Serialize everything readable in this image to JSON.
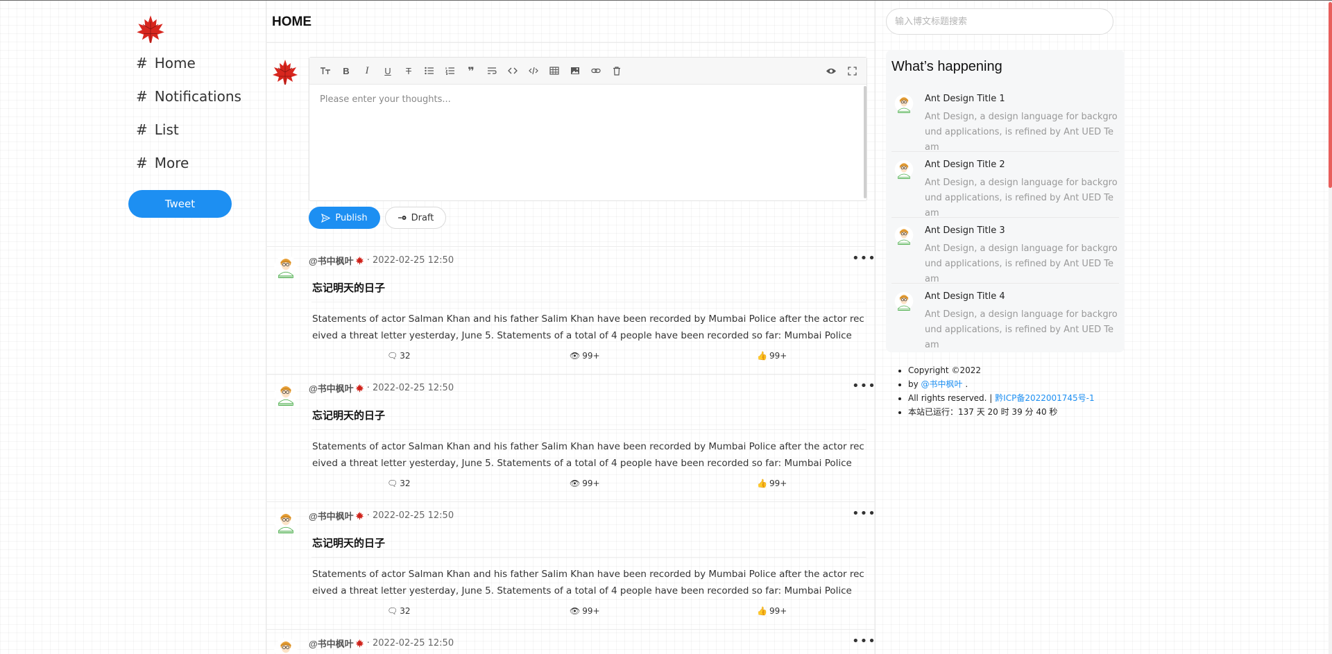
{
  "nav": {
    "items": [
      {
        "hash": "#",
        "label": "Home"
      },
      {
        "hash": "#",
        "label": "Notifications"
      },
      {
        "hash": "#",
        "label": "List"
      },
      {
        "hash": "#",
        "label": "More"
      }
    ],
    "tweet_label": "Tweet"
  },
  "header": {
    "title": "HOME"
  },
  "editor": {
    "placeholder": "Please enter your thoughts...",
    "publish_label": "Publish",
    "draft_label": "Draft",
    "toolbar_icons": [
      "header-icon",
      "bold-icon",
      "italic-icon",
      "underline-icon",
      "strikethrough-icon",
      "unordered-list-icon",
      "ordered-list-icon",
      "quote-icon",
      "wrap-icon",
      "code-icon",
      "code-block-icon",
      "table-icon",
      "image-icon",
      "link-icon",
      "delete-icon"
    ],
    "toolbar_right_icons": [
      "preview-icon",
      "fullscreen-icon"
    ]
  },
  "posts": [
    {
      "author": "@书中枫叶",
      "date": "2022-02-25 12:50",
      "title": "忘记明天的日子",
      "body": "Statements of actor Salman Khan and his father Salim Khan have been recorded by Mumbai Police after the actor received a threat letter yesterday, June 5. Statements of a total of 4 people have been recorded so far: Mumbai Police",
      "comments": "32",
      "views": "99+",
      "likes": "99+"
    },
    {
      "author": "@书中枫叶",
      "date": "2022-02-25 12:50",
      "title": "忘记明天的日子",
      "body": "Statements of actor Salman Khan and his father Salim Khan have been recorded by Mumbai Police after the actor received a threat letter yesterday, June 5. Statements of a total of 4 people have been recorded so far: Mumbai Police",
      "comments": "32",
      "views": "99+",
      "likes": "99+"
    },
    {
      "author": "@书中枫叶",
      "date": "2022-02-25 12:50",
      "title": "忘记明天的日子",
      "body": "Statements of actor Salman Khan and his father Salim Khan have been recorded by Mumbai Police after the actor received a threat letter yesterday, June 5. Statements of a total of 4 people have been recorded so far: Mumbai Police",
      "comments": "32",
      "views": "99+",
      "likes": "99+"
    },
    {
      "author": "@书中枫叶",
      "date": "2022-02-25 12:50",
      "title": "",
      "body": "",
      "comments": "",
      "views": "",
      "likes": ""
    }
  ],
  "search": {
    "placeholder": "输入博文标题搜索"
  },
  "happening": {
    "title": "What’s happening",
    "items": [
      {
        "title": "Ant Design Title 1",
        "desc": "Ant Design, a design language for background applications, is refined by Ant UED Team"
      },
      {
        "title": "Ant Design Title 2",
        "desc": "Ant Design, a design language for background applications, is refined by Ant UED Team"
      },
      {
        "title": "Ant Design Title 3",
        "desc": "Ant Design, a design language for background applications, is refined by Ant UED Team"
      },
      {
        "title": "Ant Design Title 4",
        "desc": "Ant Design, a design language for background applications, is refined by Ant UED Team"
      }
    ]
  },
  "footer": {
    "copyright": "Copyright ©2022",
    "by_prefix": "by ",
    "by_link": "@书中枫叶",
    "by_suffix": " .",
    "rights": "All rights reserved. | ",
    "icp_link": "黔ICP备2022001745号-1",
    "uptime": "本站已运行：137 天 20 时 39 分 40 秒"
  },
  "colors": {
    "accent": "#1d8ff2",
    "scroll_thumb": "#e85f5c",
    "leaf": "#d7261e"
  }
}
